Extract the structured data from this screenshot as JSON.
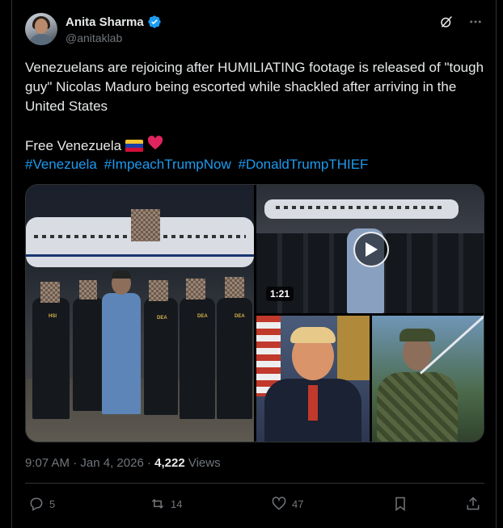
{
  "author": {
    "display_name": "Anita Sharma",
    "handle": "@anitaklab"
  },
  "tweet": {
    "body": "Venezuelans are rejoicing after HUMILIATING footage is released of \"tough guy\" Nicolas Maduro being escorted while shackled after arriving in the United States",
    "line2": "Free Venezuela",
    "hashtags": [
      "#Venezuela",
      "#ImpeachTrumpNow",
      "#DonaldTrumpTHIEF"
    ]
  },
  "media": {
    "video_duration": "1:21",
    "badges": [
      "HSI",
      "DEA",
      "DEA",
      "DEA"
    ]
  },
  "meta": {
    "time": "9:07 AM",
    "date": "Jan 4, 2026",
    "views_count": "4,222",
    "views_label": "Views"
  },
  "actions": {
    "replies": "5",
    "reposts": "14",
    "likes": "47"
  },
  "colors": {
    "accent": "#1d9bf0",
    "heart": "#f91880",
    "background": "#000000"
  }
}
